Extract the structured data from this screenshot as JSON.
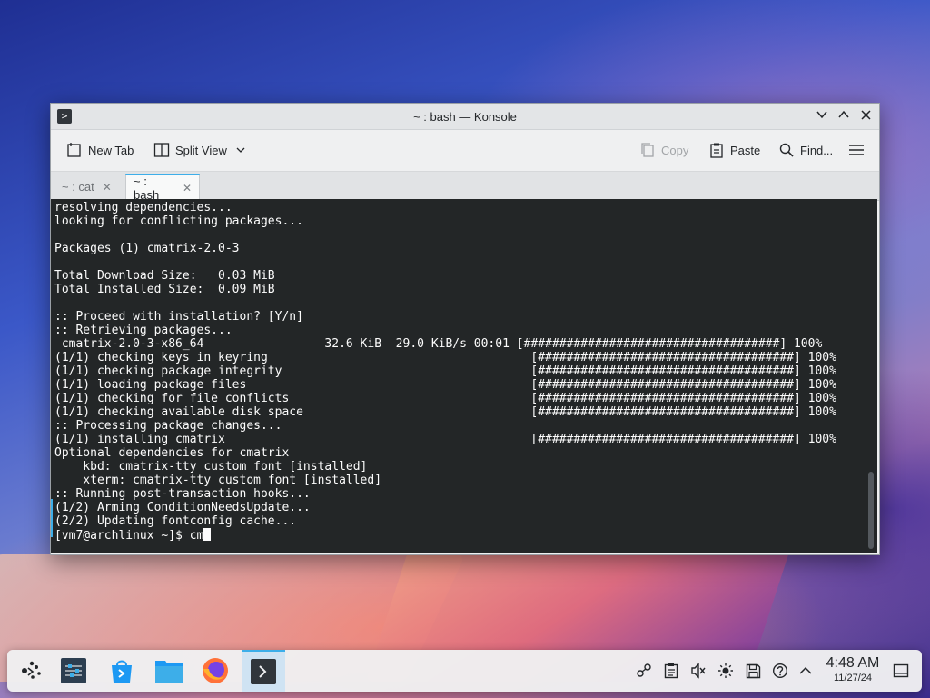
{
  "window": {
    "title": "~ : bash — Konsole",
    "controls": [
      "minimize",
      "maximize",
      "close"
    ]
  },
  "toolbar": {
    "new_tab": "New Tab",
    "split_view": "Split View",
    "copy": "Copy",
    "paste": "Paste",
    "find": "Find..."
  },
  "tabs": [
    {
      "label": "~ : cat",
      "active": false
    },
    {
      "label": "~ : bash",
      "active": true
    }
  ],
  "terminal": {
    "output": "resolving dependencies...\nlooking for conflicting packages...\n\nPackages (1) cmatrix-2.0-3\n\nTotal Download Size:   0.03 MiB\nTotal Installed Size:  0.09 MiB\n\n:: Proceed with installation? [Y/n]\n:: Retrieving packages...\n cmatrix-2.0-3-x86_64                 32.6 KiB  29.0 KiB/s 00:01 [####################################] 100%\n(1/1) checking keys in keyring                                     [####################################] 100%\n(1/1) checking package integrity                                   [####################################] 100%\n(1/1) loading package files                                        [####################################] 100%\n(1/1) checking for file conflicts                                  [####################################] 100%\n(1/1) checking available disk space                                [####################################] 100%\n:: Processing package changes...\n(1/1) installing cmatrix                                           [####################################] 100%\nOptional dependencies for cmatrix\n    kbd: cmatrix-tty custom font [installed]\n    xterm: cmatrix-tty custom font [installed]\n:: Running post-transaction hooks...\n(1/2) Arming ConditionNeedsUpdate...\n(2/2) Updating fontconfig cache...\n",
    "prompt": "[vm7@archlinux ~]$ cm"
  },
  "taskbar": {
    "apps": [
      "application-launcher-icon",
      "system-settings-icon",
      "discover-icon",
      "dolphin-icon",
      "firefox-icon",
      "konsole-icon"
    ],
    "tray": [
      "network-icon",
      "clipboard-icon",
      "volume-muted-icon",
      "brightness-icon",
      "save-icon",
      "help-icon",
      "chevron-up-icon"
    ],
    "time": "4:48 AM",
    "date": "11/27/24"
  },
  "colors": {
    "accent": "#3daee9",
    "terminal_bg": "#232627",
    "terminal_fg": "#fcfcfc"
  }
}
